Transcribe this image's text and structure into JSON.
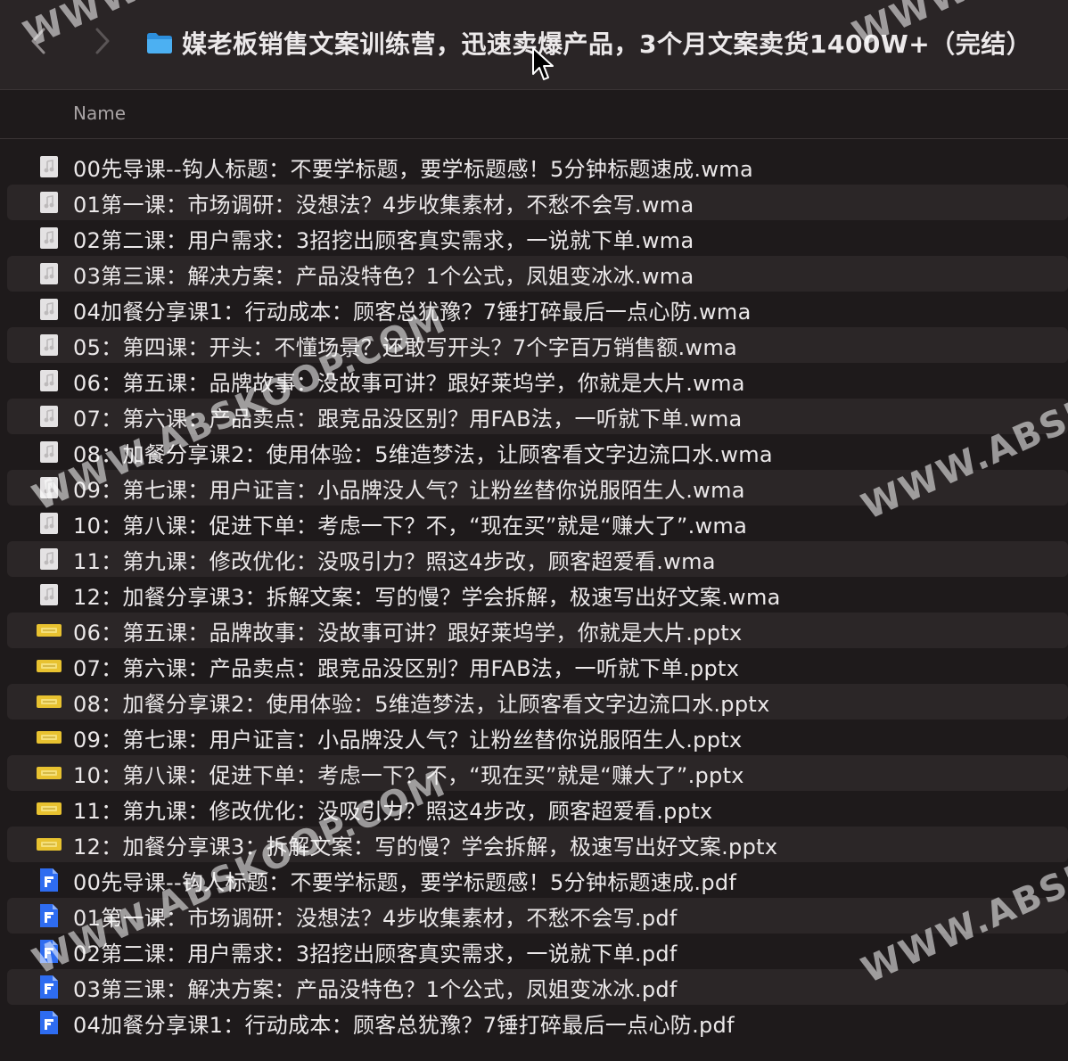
{
  "window": {
    "title": "媒老板销售文案训练营，迅速卖爆产品，3个月文案卖货1400W+（完结）",
    "back_icon": "chevron-left-icon",
    "forward_icon": "chevron-right-icon",
    "folder_icon": "folder-icon"
  },
  "columns": {
    "name": "Name"
  },
  "files": [
    {
      "name": "00先导课--钩人标题：不要学标题，要学标题感！5分钟标题速成.wma",
      "type": "audio"
    },
    {
      "name": "01第一课：市场调研：没想法？4步收集素材，不愁不会写.wma",
      "type": "audio"
    },
    {
      "name": "02第二课：用户需求：3招挖出顾客真实需求，一说就下单.wma",
      "type": "audio"
    },
    {
      "name": "03第三课：解决方案：产品没特色？1个公式，凤姐变冰冰.wma",
      "type": "audio"
    },
    {
      "name": "04加餐分享课1：行动成本：顾客总犹豫？7锤打碎最后一点心防.wma",
      "type": "audio"
    },
    {
      "name": "05：第四课：开头：不懂场景？还敢写开头？7个字百万销售额.wma",
      "type": "audio"
    },
    {
      "name": "06：第五课：品牌故事：没故事可讲？跟好莱坞学，你就是大片.wma",
      "type": "audio"
    },
    {
      "name": "07：第六课：产品卖点：跟竞品没区别？用FAB法，一听就下单.wma",
      "type": "audio"
    },
    {
      "name": "08：加餐分享课2：使用体验：5维造梦法，让顾客看文字边流口水.wma",
      "type": "audio"
    },
    {
      "name": "09：第七课：用户证言：小品牌没人气？让粉丝替你说服陌生人.wma",
      "type": "audio"
    },
    {
      "name": "10：第八课：促进下单：考虑一下？不，“现在买”就是“赚大了”.wma",
      "type": "audio"
    },
    {
      "name": "11：第九课：修改优化：没吸引力？照这4步改，顾客超爱看.wma",
      "type": "audio"
    },
    {
      "name": "12：加餐分享课3：拆解文案：写的慢？学会拆解，极速写出好文案.wma",
      "type": "audio"
    },
    {
      "name": "06：第五课：品牌故事：没故事可讲？跟好莱坞学，你就是大片.pptx",
      "type": "pptx"
    },
    {
      "name": "07：第六课：产品卖点：跟竞品没区别？用FAB法，一听就下单.pptx",
      "type": "pptx"
    },
    {
      "name": "08：加餐分享课2：使用体验：5维造梦法，让顾客看文字边流口水.pptx",
      "type": "pptx"
    },
    {
      "name": "09：第七课：用户证言：小品牌没人气？让粉丝替你说服陌生人.pptx",
      "type": "pptx"
    },
    {
      "name": "10：第八课：促进下单：考虑一下？不，“现在买”就是“赚大了”.pptx",
      "type": "pptx"
    },
    {
      "name": "11：第九课：修改优化：没吸引力？照这4步改，顾客超爱看.pptx",
      "type": "pptx"
    },
    {
      "name": "12：加餐分享课3：拆解文案：写的慢？学会拆解，极速写出好文案.pptx",
      "type": "pptx"
    },
    {
      "name": "00先导课--钩人标题：不要学标题，要学标题感！5分钟标题速成.pdf",
      "type": "pdf"
    },
    {
      "name": "01第一课：市场调研：没想法？4步收集素材，不愁不会写.pdf",
      "type": "pdf"
    },
    {
      "name": "02第二课：用户需求：3招挖出顾客真实需求，一说就下单.pdf",
      "type": "pdf"
    },
    {
      "name": "03第三课：解决方案：产品没特色？1个公式，凤姐变冰冰.pdf",
      "type": "pdf"
    },
    {
      "name": "04加餐分享课1：行动成本：顾客总犹豫？7锤打碎最后一点心防.pdf",
      "type": "pdf"
    }
  ],
  "watermarks": [
    "WWW.ABSKOOP.COM",
    "WWW.ABSKOOP.COM",
    "WWW.ABSKO",
    "WWW.ABSKO",
    "WWW",
    "WWW"
  ],
  "colors": {
    "accent_folder": "#3aa0e8",
    "pptx_icon": "#e6c12f",
    "pdf_icon": "#2f6ef0",
    "audio_icon": "#e2e0e1"
  }
}
